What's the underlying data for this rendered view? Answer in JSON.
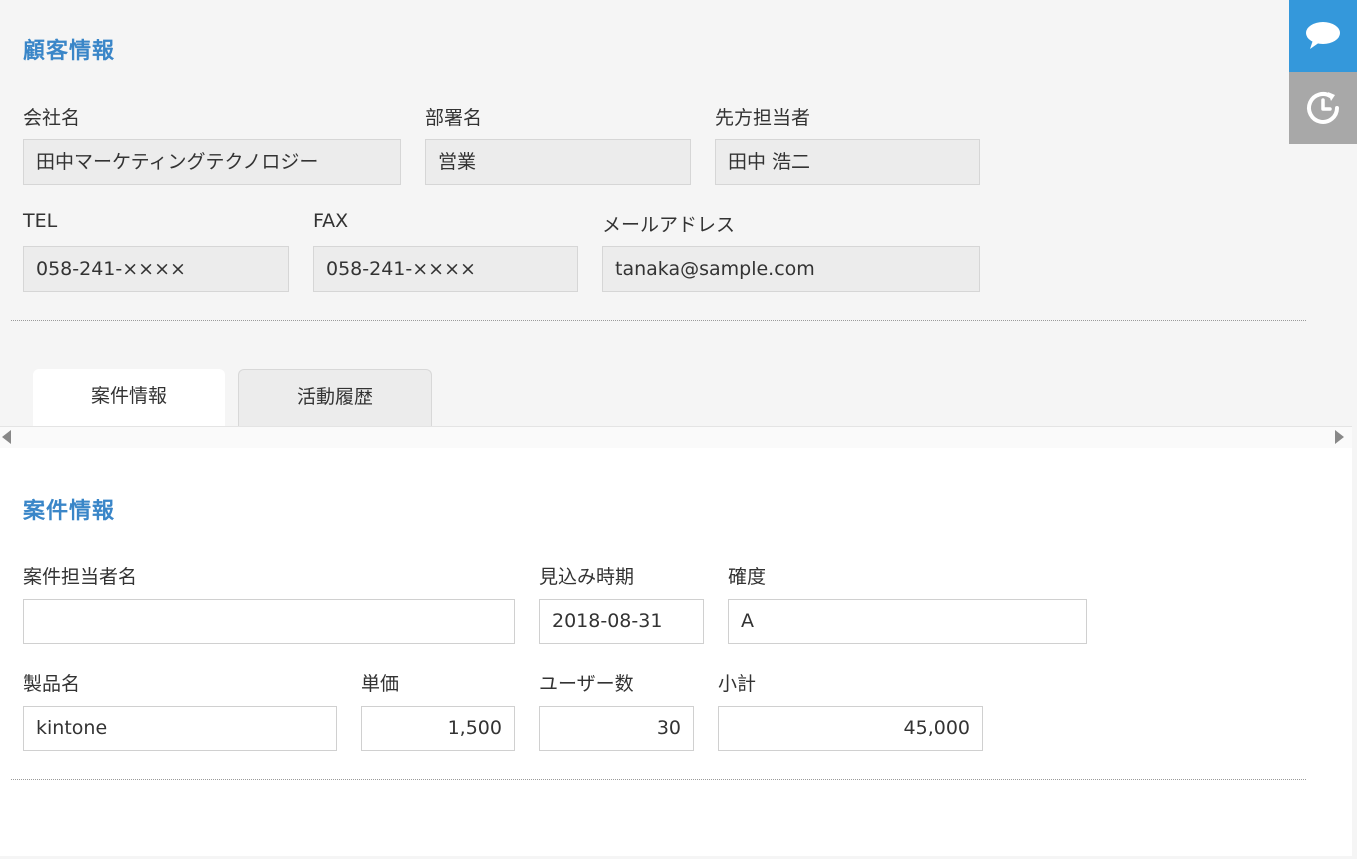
{
  "customer": {
    "title": "顧客情報",
    "company": {
      "label": "会社名",
      "value": "田中マーケティングテクノロジー"
    },
    "department": {
      "label": "部署名",
      "value": "営業"
    },
    "contact": {
      "label": "先方担当者",
      "value": "田中 浩二"
    },
    "tel": {
      "label": "TEL",
      "value": "058-241-××××"
    },
    "fax": {
      "label": "FAX",
      "value": "058-241-××××"
    },
    "email": {
      "label": "メールアドレス",
      "value": "tanaka@sample.com"
    }
  },
  "tabs": [
    {
      "label": "案件情報",
      "active": true
    },
    {
      "label": "活動履歴",
      "active": false
    }
  ],
  "deal": {
    "title": "案件情報",
    "owner": {
      "label": "案件担当者名",
      "value": ""
    },
    "expected_date": {
      "label": "見込み時期",
      "value": "2018-08-31"
    },
    "certainty": {
      "label": "確度",
      "value": "A"
    },
    "product": {
      "label": "製品名",
      "value": "kintone"
    },
    "unit_price": {
      "label": "単価",
      "value": "1,500"
    },
    "users": {
      "label": "ユーザー数",
      "value": "30"
    },
    "subtotal": {
      "label": "小計",
      "value": "45,000"
    }
  },
  "sidebar": {
    "comment_icon": "speech-bubble-icon",
    "history_icon": "history-clock-icon",
    "comment_color": "#3498db",
    "history_color": "#a8a8a8"
  }
}
